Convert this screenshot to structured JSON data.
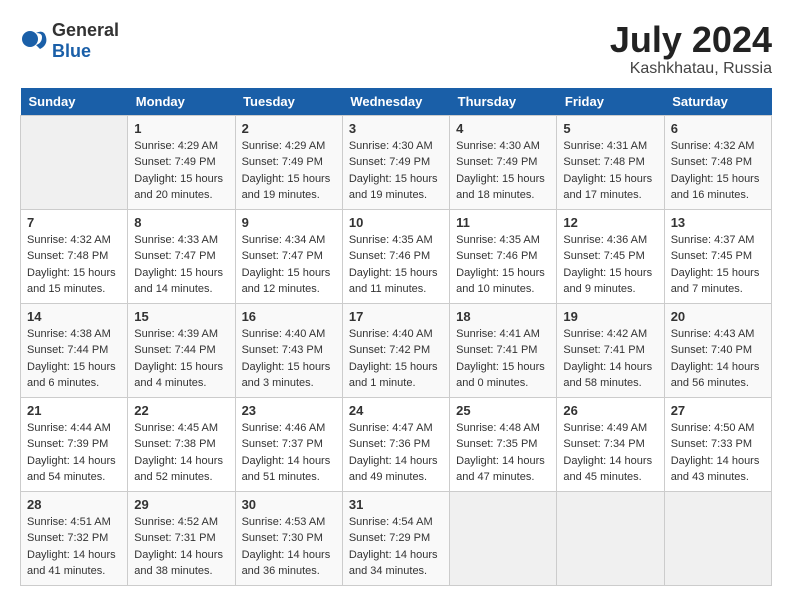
{
  "header": {
    "logo_general": "General",
    "logo_blue": "Blue",
    "month_year": "July 2024",
    "location": "Kashkhatau, Russia"
  },
  "weekdays": [
    "Sunday",
    "Monday",
    "Tuesday",
    "Wednesday",
    "Thursday",
    "Friday",
    "Saturday"
  ],
  "weeks": [
    [
      {
        "day": "",
        "info": ""
      },
      {
        "day": "1",
        "info": "Sunrise: 4:29 AM\nSunset: 7:49 PM\nDaylight: 15 hours\nand 20 minutes."
      },
      {
        "day": "2",
        "info": "Sunrise: 4:29 AM\nSunset: 7:49 PM\nDaylight: 15 hours\nand 19 minutes."
      },
      {
        "day": "3",
        "info": "Sunrise: 4:30 AM\nSunset: 7:49 PM\nDaylight: 15 hours\nand 19 minutes."
      },
      {
        "day": "4",
        "info": "Sunrise: 4:30 AM\nSunset: 7:49 PM\nDaylight: 15 hours\nand 18 minutes."
      },
      {
        "day": "5",
        "info": "Sunrise: 4:31 AM\nSunset: 7:48 PM\nDaylight: 15 hours\nand 17 minutes."
      },
      {
        "day": "6",
        "info": "Sunrise: 4:32 AM\nSunset: 7:48 PM\nDaylight: 15 hours\nand 16 minutes."
      }
    ],
    [
      {
        "day": "7",
        "info": "Sunrise: 4:32 AM\nSunset: 7:48 PM\nDaylight: 15 hours\nand 15 minutes."
      },
      {
        "day": "8",
        "info": "Sunrise: 4:33 AM\nSunset: 7:47 PM\nDaylight: 15 hours\nand 14 minutes."
      },
      {
        "day": "9",
        "info": "Sunrise: 4:34 AM\nSunset: 7:47 PM\nDaylight: 15 hours\nand 12 minutes."
      },
      {
        "day": "10",
        "info": "Sunrise: 4:35 AM\nSunset: 7:46 PM\nDaylight: 15 hours\nand 11 minutes."
      },
      {
        "day": "11",
        "info": "Sunrise: 4:35 AM\nSunset: 7:46 PM\nDaylight: 15 hours\nand 10 minutes."
      },
      {
        "day": "12",
        "info": "Sunrise: 4:36 AM\nSunset: 7:45 PM\nDaylight: 15 hours\nand 9 minutes."
      },
      {
        "day": "13",
        "info": "Sunrise: 4:37 AM\nSunset: 7:45 PM\nDaylight: 15 hours\nand 7 minutes."
      }
    ],
    [
      {
        "day": "14",
        "info": "Sunrise: 4:38 AM\nSunset: 7:44 PM\nDaylight: 15 hours\nand 6 minutes."
      },
      {
        "day": "15",
        "info": "Sunrise: 4:39 AM\nSunset: 7:44 PM\nDaylight: 15 hours\nand 4 minutes."
      },
      {
        "day": "16",
        "info": "Sunrise: 4:40 AM\nSunset: 7:43 PM\nDaylight: 15 hours\nand 3 minutes."
      },
      {
        "day": "17",
        "info": "Sunrise: 4:40 AM\nSunset: 7:42 PM\nDaylight: 15 hours\nand 1 minute."
      },
      {
        "day": "18",
        "info": "Sunrise: 4:41 AM\nSunset: 7:41 PM\nDaylight: 15 hours\nand 0 minutes."
      },
      {
        "day": "19",
        "info": "Sunrise: 4:42 AM\nSunset: 7:41 PM\nDaylight: 14 hours\nand 58 minutes."
      },
      {
        "day": "20",
        "info": "Sunrise: 4:43 AM\nSunset: 7:40 PM\nDaylight: 14 hours\nand 56 minutes."
      }
    ],
    [
      {
        "day": "21",
        "info": "Sunrise: 4:44 AM\nSunset: 7:39 PM\nDaylight: 14 hours\nand 54 minutes."
      },
      {
        "day": "22",
        "info": "Sunrise: 4:45 AM\nSunset: 7:38 PM\nDaylight: 14 hours\nand 52 minutes."
      },
      {
        "day": "23",
        "info": "Sunrise: 4:46 AM\nSunset: 7:37 PM\nDaylight: 14 hours\nand 51 minutes."
      },
      {
        "day": "24",
        "info": "Sunrise: 4:47 AM\nSunset: 7:36 PM\nDaylight: 14 hours\nand 49 minutes."
      },
      {
        "day": "25",
        "info": "Sunrise: 4:48 AM\nSunset: 7:35 PM\nDaylight: 14 hours\nand 47 minutes."
      },
      {
        "day": "26",
        "info": "Sunrise: 4:49 AM\nSunset: 7:34 PM\nDaylight: 14 hours\nand 45 minutes."
      },
      {
        "day": "27",
        "info": "Sunrise: 4:50 AM\nSunset: 7:33 PM\nDaylight: 14 hours\nand 43 minutes."
      }
    ],
    [
      {
        "day": "28",
        "info": "Sunrise: 4:51 AM\nSunset: 7:32 PM\nDaylight: 14 hours\nand 41 minutes."
      },
      {
        "day": "29",
        "info": "Sunrise: 4:52 AM\nSunset: 7:31 PM\nDaylight: 14 hours\nand 38 minutes."
      },
      {
        "day": "30",
        "info": "Sunrise: 4:53 AM\nSunset: 7:30 PM\nDaylight: 14 hours\nand 36 minutes."
      },
      {
        "day": "31",
        "info": "Sunrise: 4:54 AM\nSunset: 7:29 PM\nDaylight: 14 hours\nand 34 minutes."
      },
      {
        "day": "",
        "info": ""
      },
      {
        "day": "",
        "info": ""
      },
      {
        "day": "",
        "info": ""
      }
    ]
  ]
}
